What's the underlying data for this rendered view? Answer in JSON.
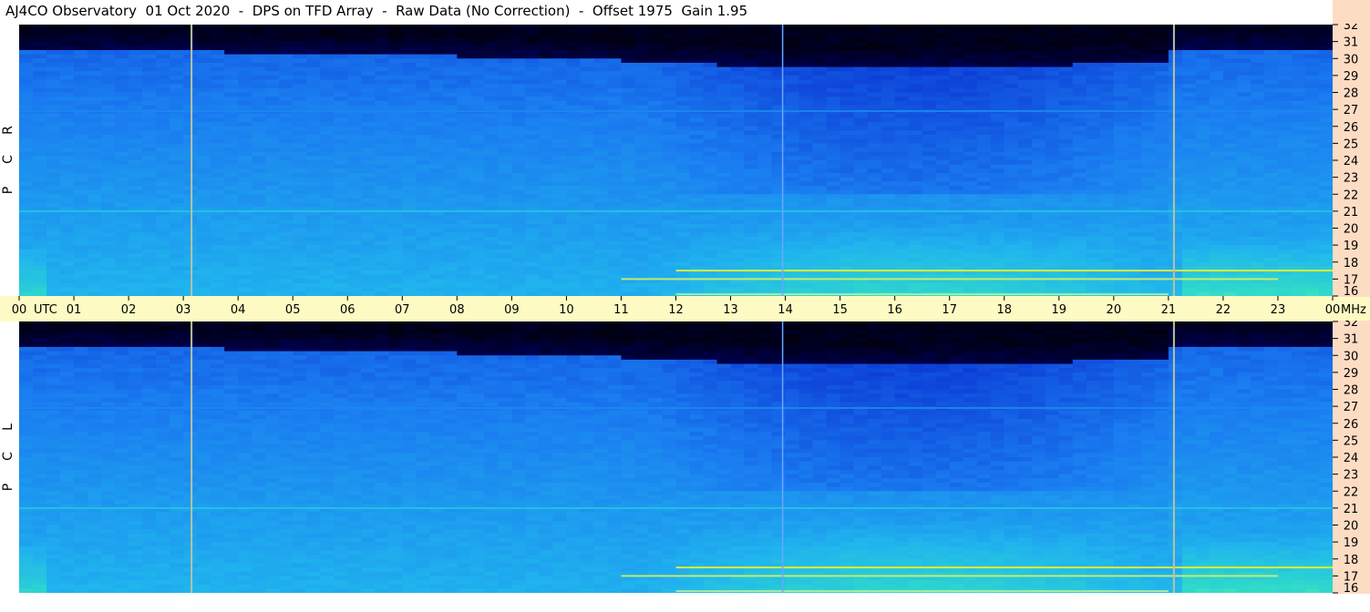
{
  "title": "AJ4CO Observatory  01 Oct 2020  -  DPS on TFD Array  -  Raw Data (No Correction)  -  Offset 1975  Gain 1.95",
  "panels": [
    {
      "id": "rcp",
      "label": "R C P"
    },
    {
      "id": "lcp",
      "label": "L C P"
    }
  ],
  "colors": {
    "background": "#ffffff",
    "time_axis_bg": "#fdfbc3",
    "freq_axis_bg": "#fddcc4",
    "colormap": [
      "#000000",
      "#00006e",
      "#0a2fd0",
      "#1a7cf0",
      "#20b4ee",
      "#30dcc8",
      "#b8f0a0",
      "#fff200",
      "#ff3b3b"
    ]
  },
  "chart_data": {
    "type": "heatmap",
    "title": "AJ4CO Observatory  01 Oct 2020  -  DPS on TFD Array  -  Raw Data (No Correction)  -  Offset 1975  Gain 1.95",
    "x_ticks": [
      "00",
      "01",
      "02",
      "03",
      "04",
      "05",
      "06",
      "07",
      "08",
      "09",
      "10",
      "11",
      "12",
      "13",
      "14",
      "15",
      "16",
      "17",
      "18",
      "19",
      "20",
      "21",
      "22",
      "23",
      "00"
    ],
    "x_unit_left": "UTC",
    "x_unit_right": "MHz",
    "xlim_hours": [
      0,
      24
    ],
    "y_ticks": [
      "32",
      "31",
      "30",
      "29",
      "28",
      "27",
      "26",
      "25",
      "24",
      "23",
      "22",
      "21",
      "20",
      "19",
      "18",
      "17",
      "16"
    ],
    "ylim_mhz": [
      16,
      32
    ],
    "panels": [
      "R C P",
      "L C P"
    ],
    "markers_hours": [
      3.15,
      13.95,
      21.1
    ],
    "bright_bands": [
      {
        "start_hours": 12.0,
        "end_hours": 24.0,
        "freq_mhz": 17.5,
        "level": 0.85
      },
      {
        "start_hours": 11.0,
        "end_hours": 23.0,
        "freq_mhz": 17.0,
        "level": 0.8
      },
      {
        "start_hours": 12.0,
        "end_hours": 21.0,
        "freq_mhz": 16.1,
        "level": 0.75
      },
      {
        "start_hours": 0.0,
        "end_hours": 24.0,
        "freq_mhz": 21.0,
        "level": 0.55
      },
      {
        "start_hours": 0.0,
        "end_hours": 24.0,
        "freq_mhz": 26.9,
        "level": 0.4
      }
    ]
  }
}
